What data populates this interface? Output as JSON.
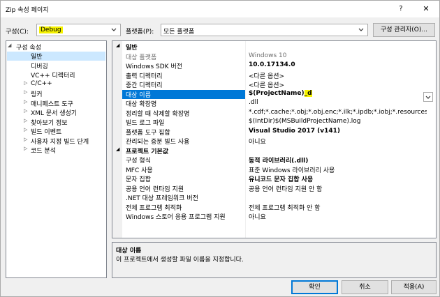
{
  "window": {
    "title": "Zip 속성 페이지",
    "help_label": "?",
    "close_label": "✕"
  },
  "toolbar": {
    "config_label": "구성(C):",
    "config_value": "Debug",
    "platform_label": "플랫폼(P):",
    "platform_value": "모든 플랫폼",
    "config_manager_label": "구성 관리자(O)..."
  },
  "tree": {
    "root": "구성 속성",
    "items": [
      {
        "label": "일반",
        "expandable": false,
        "selected": true
      },
      {
        "label": "디버깅",
        "expandable": false
      },
      {
        "label": "VC++ 디렉터리",
        "expandable": false
      },
      {
        "label": "C/C++",
        "expandable": true
      },
      {
        "label": "링커",
        "expandable": true
      },
      {
        "label": "매니페스트 도구",
        "expandable": true
      },
      {
        "label": "XML 문서 생성기",
        "expandable": true
      },
      {
        "label": "찾아보기 정보",
        "expandable": true
      },
      {
        "label": "빌드 이벤트",
        "expandable": true
      },
      {
        "label": "사용자 지정 빌드 단계",
        "expandable": true
      },
      {
        "label": "코드 분석",
        "expandable": true
      }
    ]
  },
  "grid": {
    "sections": [
      {
        "title": "일반",
        "rows": [
          {
            "name": "대상 플랫폼",
            "value": "Windows 10",
            "style": "gray"
          },
          {
            "name": "Windows SDK 버전",
            "value": "10.0.17134.0",
            "style": "bold"
          },
          {
            "name": "출력 디렉터리",
            "value": "<다른 옵션>",
            "style": ""
          },
          {
            "name": "중간 디렉터리",
            "value": "<다른 옵션>",
            "style": ""
          },
          {
            "name": "대상 이름",
            "value_prefix": "$(ProjectName)",
            "value_highlight": "_d",
            "style": "bold sel"
          },
          {
            "name": "대상 확장명",
            "value": ".dll",
            "style": ""
          },
          {
            "name": "정리할 때 삭제할 확장명",
            "value": "*.cdf;*.cache;*.obj;*.obj.enc;*.ilk;*.ipdb;*.iobj;*.resources;*.tlb;*.tli;*.",
            "style": ""
          },
          {
            "name": "빌드 로그 파일",
            "value": "$(IntDir)$(MSBuildProjectName).log",
            "style": ""
          },
          {
            "name": "플랫폼 도구 집합",
            "value": "Visual Studio 2017 (v141)",
            "style": "bold"
          },
          {
            "name": "관리되는 증분 빌드 사용",
            "value": "아니요",
            "style": ""
          }
        ]
      },
      {
        "title": "프로젝트 기본값",
        "rows": [
          {
            "name": "구성 형식",
            "value": "동적 라이브러리(.dll)",
            "style": "bold"
          },
          {
            "name": "MFC 사용",
            "value": "표준 Windows 라이브러리 사용",
            "style": ""
          },
          {
            "name": "문자 집합",
            "value": "유니코드 문자 집합 사용",
            "style": "bold"
          },
          {
            "name": "공용 언어 런타임 지원",
            "value": "공용 언어 런타임 지원 안 함",
            "style": ""
          },
          {
            "name": ".NET 대상 프레임워크 버전",
            "value": "",
            "style": ""
          },
          {
            "name": "전체 프로그램 최적화",
            "value": "전체 프로그램 최적화 안 함",
            "style": ""
          },
          {
            "name": "Windows 스토어 응용 프로그램 지원",
            "value": "아니요",
            "style": ""
          }
        ]
      }
    ]
  },
  "description": {
    "title": "대상 이름",
    "text": "이 프로젝트에서 생성할 파일 이름을 지정합니다."
  },
  "buttons": {
    "ok": "확인",
    "cancel": "취소",
    "apply": "적용(A)"
  },
  "colors": {
    "highlight": "#f5f200",
    "selection": "#0078d7",
    "tree_selection": "#cce8ff"
  }
}
